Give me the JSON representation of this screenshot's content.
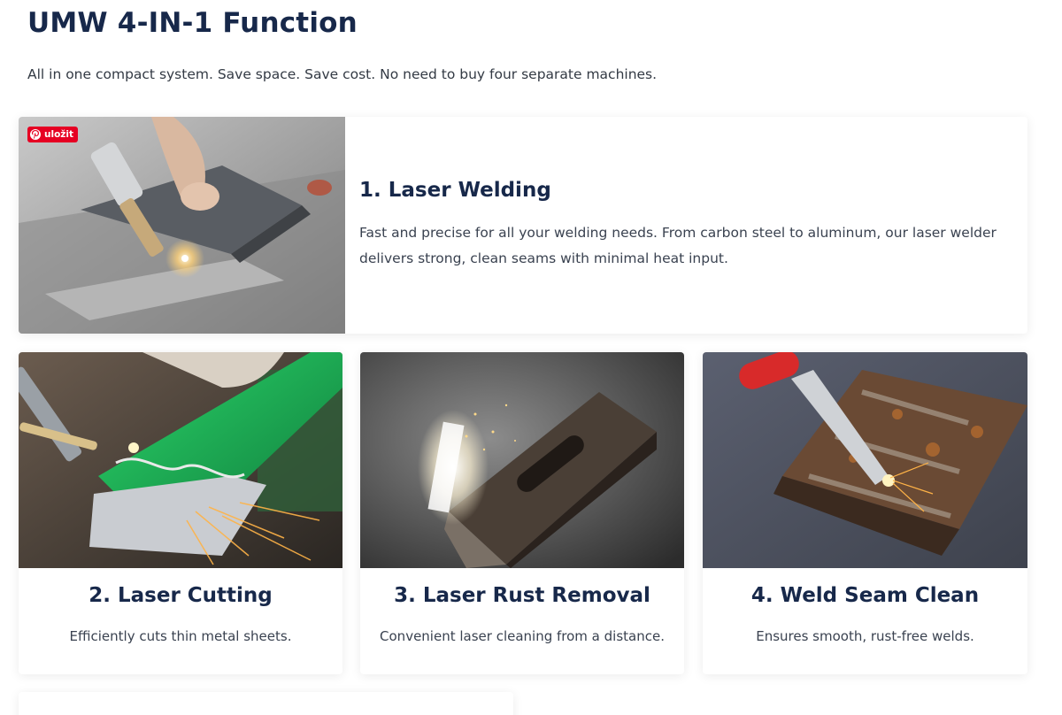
{
  "header": {
    "title": "UMW 4-IN-1 Function",
    "subtitle": "All in one compact system. Save space. Save cost. No need to buy four separate machines."
  },
  "pin_button": {
    "label": "uložit",
    "icon": "pinterest-icon",
    "color": "#e60023"
  },
  "features": [
    {
      "heading": "1. Laser Welding",
      "description": "Fast and precise for all your welding needs. From carbon steel to aluminum, our laser welder delivers strong, clean seams with minimal heat input."
    },
    {
      "heading": "2. Laser Cutting",
      "description": "Efficiently cuts thin metal sheets."
    },
    {
      "heading": "3. Laser Rust Removal",
      "description": "Convenient laser cleaning from a distance."
    },
    {
      "heading": "4. Weld Seam Clean",
      "description": "Ensures smooth, rust-free welds."
    }
  ],
  "colors": {
    "heading": "#17284a",
    "text": "#3a4250",
    "card_bg": "#ffffff"
  }
}
